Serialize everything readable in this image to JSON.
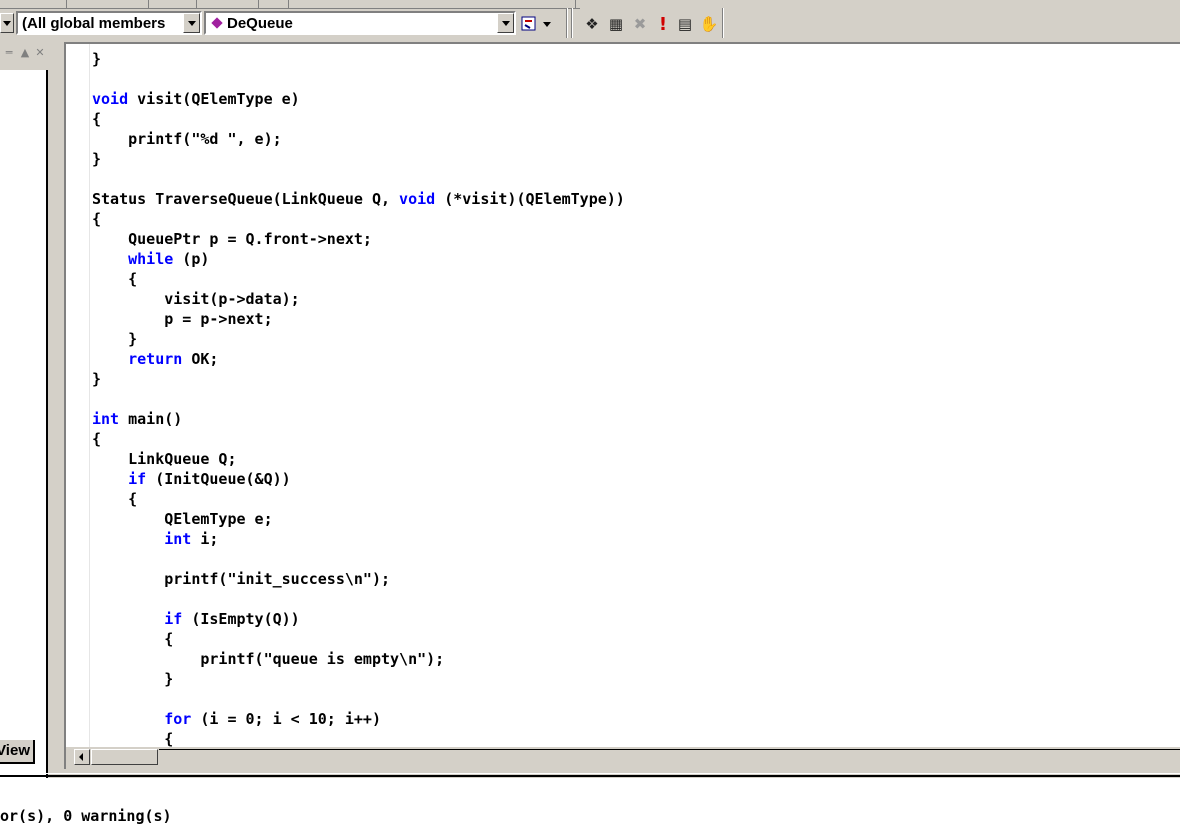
{
  "toolbar": {
    "class_combo_text": "",
    "members_combo_text": "(All global members",
    "function_combo_text": "DeQueue",
    "icons": [
      "wizard-dropdown-icon",
      "compile-icon",
      "build-icon",
      "stop-build-icon",
      "execute-icon",
      "step-into-icon",
      "breakpoint-hand-icon"
    ],
    "icon_glyphs": {
      "compile": "❖",
      "build": "▦",
      "stop": "✖",
      "execute": "!",
      "step": "▤",
      "hand": "✋"
    }
  },
  "leftpane": {
    "tab_label": "View"
  },
  "editor": {
    "lines": [
      [
        {
          "t": "}"
        }
      ],
      [
        {
          "t": ""
        }
      ],
      [
        {
          "t": "void",
          "k": 1
        },
        {
          "t": " visit(QElemType e)"
        }
      ],
      [
        {
          "t": "{"
        }
      ],
      [
        {
          "t": "    printf(\"%d \", e);"
        }
      ],
      [
        {
          "t": "}"
        }
      ],
      [
        {
          "t": ""
        }
      ],
      [
        {
          "t": "Status TraverseQueue(LinkQueue Q, "
        },
        {
          "t": "void",
          "k": 1
        },
        {
          "t": " (*visit)(QElemType))"
        }
      ],
      [
        {
          "t": "{"
        }
      ],
      [
        {
          "t": "    QueuePtr p = Q.front->next;"
        }
      ],
      [
        {
          "t": "    "
        },
        {
          "t": "while",
          "k": 1
        },
        {
          "t": " (p)"
        }
      ],
      [
        {
          "t": "    {"
        }
      ],
      [
        {
          "t": "        visit(p->data);"
        }
      ],
      [
        {
          "t": "        p = p->next;"
        }
      ],
      [
        {
          "t": "    }"
        }
      ],
      [
        {
          "t": "    "
        },
        {
          "t": "return",
          "k": 1
        },
        {
          "t": " OK;"
        }
      ],
      [
        {
          "t": "}"
        }
      ],
      [
        {
          "t": ""
        }
      ],
      [
        {
          "t": "int",
          "k": 1
        },
        {
          "t": " main()"
        }
      ],
      [
        {
          "t": "{"
        }
      ],
      [
        {
          "t": "    LinkQueue Q;"
        }
      ],
      [
        {
          "t": "    "
        },
        {
          "t": "if",
          "k": 1
        },
        {
          "t": " (InitQueue(&Q))"
        }
      ],
      [
        {
          "t": "    {"
        }
      ],
      [
        {
          "t": "        QElemType e;"
        }
      ],
      [
        {
          "t": "        "
        },
        {
          "t": "int",
          "k": 1
        },
        {
          "t": " i;"
        }
      ],
      [
        {
          "t": ""
        }
      ],
      [
        {
          "t": "        printf(\"init_success\\n\");"
        }
      ],
      [
        {
          "t": ""
        }
      ],
      [
        {
          "t": "        "
        },
        {
          "t": "if",
          "k": 1
        },
        {
          "t": " (IsEmpty(Q))"
        }
      ],
      [
        {
          "t": "        {"
        }
      ],
      [
        {
          "t": "            printf(\"queue is empty\\n\");"
        }
      ],
      [
        {
          "t": "        }"
        }
      ],
      [
        {
          "t": ""
        }
      ],
      [
        {
          "t": "        "
        },
        {
          "t": "for",
          "k": 1
        },
        {
          "t": " (i = 0; i < 10; i++)"
        }
      ],
      [
        {
          "t": "        {"
        }
      ]
    ],
    "keyword_color": "#0000ff"
  },
  "output": {
    "status_line": "or(s), 0 warning(s)"
  }
}
